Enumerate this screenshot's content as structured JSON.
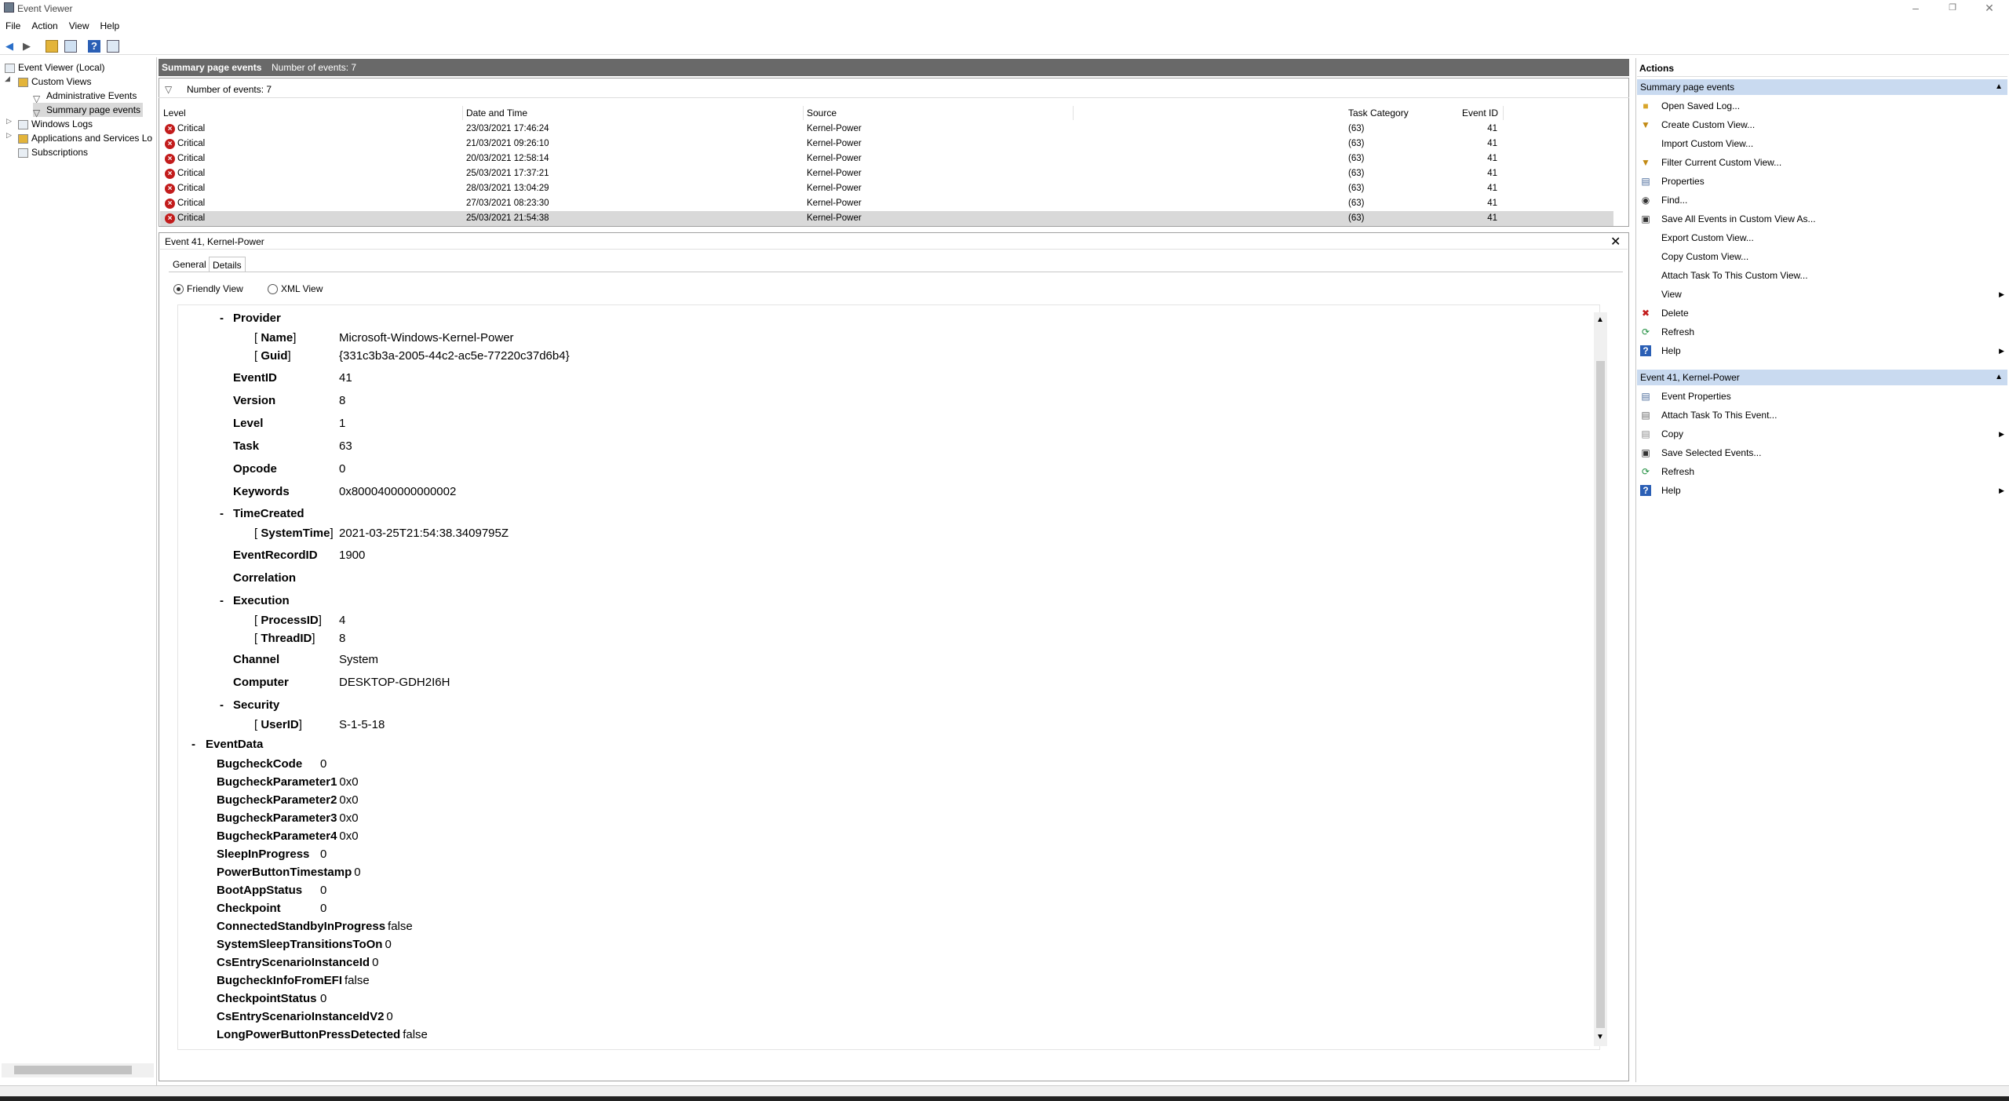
{
  "window": {
    "title": "Event Viewer"
  },
  "menu": [
    "File",
    "Action",
    "View",
    "Help"
  ],
  "tree": {
    "root": "Event Viewer (Local)",
    "custom_views": "Custom Views",
    "admin_events": "Administrative Events",
    "summary_events": "Summary page events",
    "windows_logs": "Windows Logs",
    "app_services": "Applications and Services Lo",
    "subscriptions": "Subscriptions"
  },
  "list": {
    "header_title": "Summary page events",
    "header_count": "Number of events: 7",
    "filter_text": "Number of events: 7",
    "columns": {
      "level": "Level",
      "date": "Date and Time",
      "source": "Source",
      "event_id": "Event ID",
      "task": "Task Category"
    },
    "rows": [
      {
        "level": "Critical",
        "date": "23/03/2021 17:46:24",
        "source": "Kernel-Power",
        "id": "41",
        "task": "(63)"
      },
      {
        "level": "Critical",
        "date": "21/03/2021 09:26:10",
        "source": "Kernel-Power",
        "id": "41",
        "task": "(63)"
      },
      {
        "level": "Critical",
        "date": "20/03/2021 12:58:14",
        "source": "Kernel-Power",
        "id": "41",
        "task": "(63)"
      },
      {
        "level": "Critical",
        "date": "25/03/2021 17:37:21",
        "source": "Kernel-Power",
        "id": "41",
        "task": "(63)"
      },
      {
        "level": "Critical",
        "date": "28/03/2021 13:04:29",
        "source": "Kernel-Power",
        "id": "41",
        "task": "(63)"
      },
      {
        "level": "Critical",
        "date": "27/03/2021 08:23:30",
        "source": "Kernel-Power",
        "id": "41",
        "task": "(63)"
      },
      {
        "level": "Critical",
        "date": "25/03/2021 21:54:38",
        "source": "Kernel-Power",
        "id": "41",
        "task": "(63)"
      }
    ]
  },
  "detail": {
    "title": "Event 41, Kernel-Power",
    "tab_general": "General",
    "tab_details": "Details",
    "radio_friendly": "Friendly View",
    "radio_xml": "XML View",
    "provider": "Provider",
    "name_key": "Name",
    "name_val": "Microsoft-Windows-Kernel-Power",
    "guid_key": "Guid",
    "guid_val": "{331c3b3a-2005-44c2-ac5e-77220c37d6b4}",
    "eventid_key": "EventID",
    "eventid_val": "41",
    "version_key": "Version",
    "version_val": "8",
    "level_key": "Level",
    "level_val": "1",
    "task_key": "Task",
    "task_val": "63",
    "opcode_key": "Opcode",
    "opcode_val": "0",
    "keywords_key": "Keywords",
    "keywords_val": "0x8000400000000002",
    "timecreated": "TimeCreated",
    "systemtime_key": "SystemTime",
    "systemtime_val": "2021-03-25T21:54:38.3409795Z",
    "recordid_key": "EventRecordID",
    "recordid_val": "1900",
    "correlation": "Correlation",
    "execution": "Execution",
    "processid_key": "ProcessID",
    "processid_val": "4",
    "threadid_key": "ThreadID",
    "threadid_val": "8",
    "channel_key": "Channel",
    "channel_val": "System",
    "computer_key": "Computer",
    "computer_val": "DESKTOP-GDH2I6H",
    "security": "Security",
    "userid_key": "UserID",
    "userid_val": "S-1-5-18",
    "eventdata": "EventData",
    "data": [
      {
        "k": "BugcheckCode",
        "v": "0"
      },
      {
        "k": "BugcheckParameter1",
        "v": "0x0"
      },
      {
        "k": "BugcheckParameter2",
        "v": "0x0"
      },
      {
        "k": "BugcheckParameter3",
        "v": "0x0"
      },
      {
        "k": "BugcheckParameter4",
        "v": "0x0"
      },
      {
        "k": "SleepInProgress",
        "v": "0"
      },
      {
        "k": "PowerButtonTimestamp",
        "v": "0"
      },
      {
        "k": "BootAppStatus",
        "v": "0"
      },
      {
        "k": "Checkpoint",
        "v": "0"
      },
      {
        "k": "ConnectedStandbyInProgress",
        "v": "false"
      },
      {
        "k": "SystemSleepTransitionsToOn",
        "v": "0"
      },
      {
        "k": "CsEntryScenarioInstanceId",
        "v": "0"
      },
      {
        "k": "BugcheckInfoFromEFI",
        "v": "false"
      },
      {
        "k": "CheckpointStatus",
        "v": "0"
      },
      {
        "k": "CsEntryScenarioInstanceIdV2",
        "v": "0"
      },
      {
        "k": "LongPowerButtonPressDetected",
        "v": "false"
      }
    ]
  },
  "actions": {
    "title": "Actions",
    "section1": "Summary page events",
    "items1": [
      {
        "label": "Open Saved Log...",
        "icon": "folder-icon"
      },
      {
        "label": "Create Custom View...",
        "icon": "filter-icon"
      },
      {
        "label": "Import Custom View...",
        "icon": ""
      },
      {
        "label": "Filter Current Custom View...",
        "icon": "filter-icon"
      },
      {
        "label": "Properties",
        "icon": "properties-icon"
      },
      {
        "label": "Find...",
        "icon": "binoculars-icon"
      },
      {
        "label": "Save All Events in Custom View As...",
        "icon": "save-icon"
      },
      {
        "label": "Export Custom View...",
        "icon": ""
      },
      {
        "label": "Copy Custom View...",
        "icon": ""
      },
      {
        "label": "Attach Task To This Custom View...",
        "icon": ""
      },
      {
        "label": "View",
        "icon": "",
        "sub": true
      },
      {
        "label": "Delete",
        "icon": "delete-icon"
      },
      {
        "label": "Refresh",
        "icon": "refresh-icon"
      },
      {
        "label": "Help",
        "icon": "help-icon",
        "sub": true
      }
    ],
    "section2": "Event 41, Kernel-Power",
    "items2": [
      {
        "label": "Event Properties",
        "icon": "properties-icon"
      },
      {
        "label": "Attach Task To This Event...",
        "icon": "task-icon"
      },
      {
        "label": "Copy",
        "icon": "copy-icon",
        "sub": true
      },
      {
        "label": "Save Selected Events...",
        "icon": "save-icon"
      },
      {
        "label": "Refresh",
        "icon": "refresh-icon"
      },
      {
        "label": "Help",
        "icon": "help-icon",
        "sub": true
      }
    ]
  }
}
